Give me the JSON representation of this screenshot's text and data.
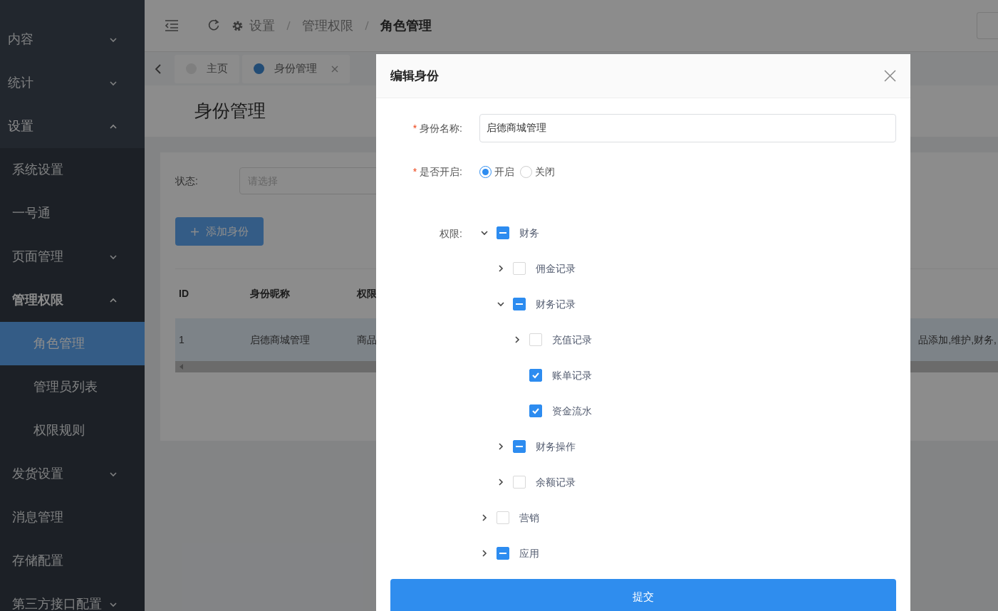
{
  "sidebar": {
    "items": [
      {
        "label": "内容",
        "expanded": false,
        "selected": false
      },
      {
        "label": "统计",
        "expanded": false,
        "selected": false
      },
      {
        "label": "设置",
        "expanded": true,
        "selected": false,
        "children": [
          {
            "label": "系统设置",
            "selected": false
          },
          {
            "label": "一号通",
            "selected": false
          },
          {
            "label": "页面管理",
            "expanded": false,
            "selected": false
          },
          {
            "label": "管理权限",
            "expanded": true,
            "selected": false,
            "children": [
              {
                "label": "角色管理",
                "selected": true
              },
              {
                "label": "管理员列表",
                "selected": false
              },
              {
                "label": "权限规则",
                "selected": false
              }
            ]
          },
          {
            "label": "发货设置",
            "expanded": false,
            "selected": false
          },
          {
            "label": "消息管理",
            "selected": false
          },
          {
            "label": "存储配置",
            "selected": false
          },
          {
            "label": "第三方接口配置",
            "expanded": false,
            "selected": false
          }
        ]
      }
    ]
  },
  "breadcrumb": [
    "设置",
    "管理权限",
    "角色管理"
  ],
  "tabs": [
    {
      "label": "主页",
      "selected": false,
      "closable": false
    },
    {
      "label": "身份管理",
      "selected": true,
      "closable": true
    }
  ],
  "page_title": "身份管理",
  "filter": {
    "label": "状态:",
    "placeholder": "请选择"
  },
  "add_button": "添加身份",
  "table": {
    "columns": [
      "ID",
      "身份昵称",
      "权限"
    ],
    "rows": [
      {
        "cells": [
          "1",
          "启德商城管理",
          "商品"
        ],
        "right_fragment": "品添加,维护,财务,"
      }
    ]
  },
  "dialog": {
    "title": "编辑身份",
    "name_field": {
      "label": "身份名称:",
      "required_mark": "*",
      "value": "启德商城管理"
    },
    "enabled": {
      "label": "是否开启:",
      "required_mark": "*",
      "options": [
        {
          "label": "开启",
          "selected": true
        },
        {
          "label": "关闭",
          "selected": false
        }
      ]
    },
    "permissions": {
      "label": "权限:",
      "tree": [
        {
          "label": "财务",
          "expanded": true,
          "indeterminate": true,
          "children": [
            {
              "label": "佣金记录",
              "expanded": false,
              "checked": false
            },
            {
              "label": "财务记录",
              "expanded": true,
              "indeterminate": true,
              "children": [
                {
                  "label": "充值记录",
                  "expanded": false,
                  "checked": false
                },
                {
                  "label": "账单记录",
                  "checked": true
                },
                {
                  "label": "资金流水",
                  "checked": true
                }
              ]
            },
            {
              "label": "财务操作",
              "expanded": false,
              "indeterminate": true
            },
            {
              "label": "余额记录",
              "expanded": false,
              "checked": false
            }
          ]
        },
        {
          "label": "营销",
          "expanded": false,
          "checked": false
        },
        {
          "label": "应用",
          "expanded": false,
          "indeterminate": true
        }
      ]
    },
    "submit": "提交"
  }
}
